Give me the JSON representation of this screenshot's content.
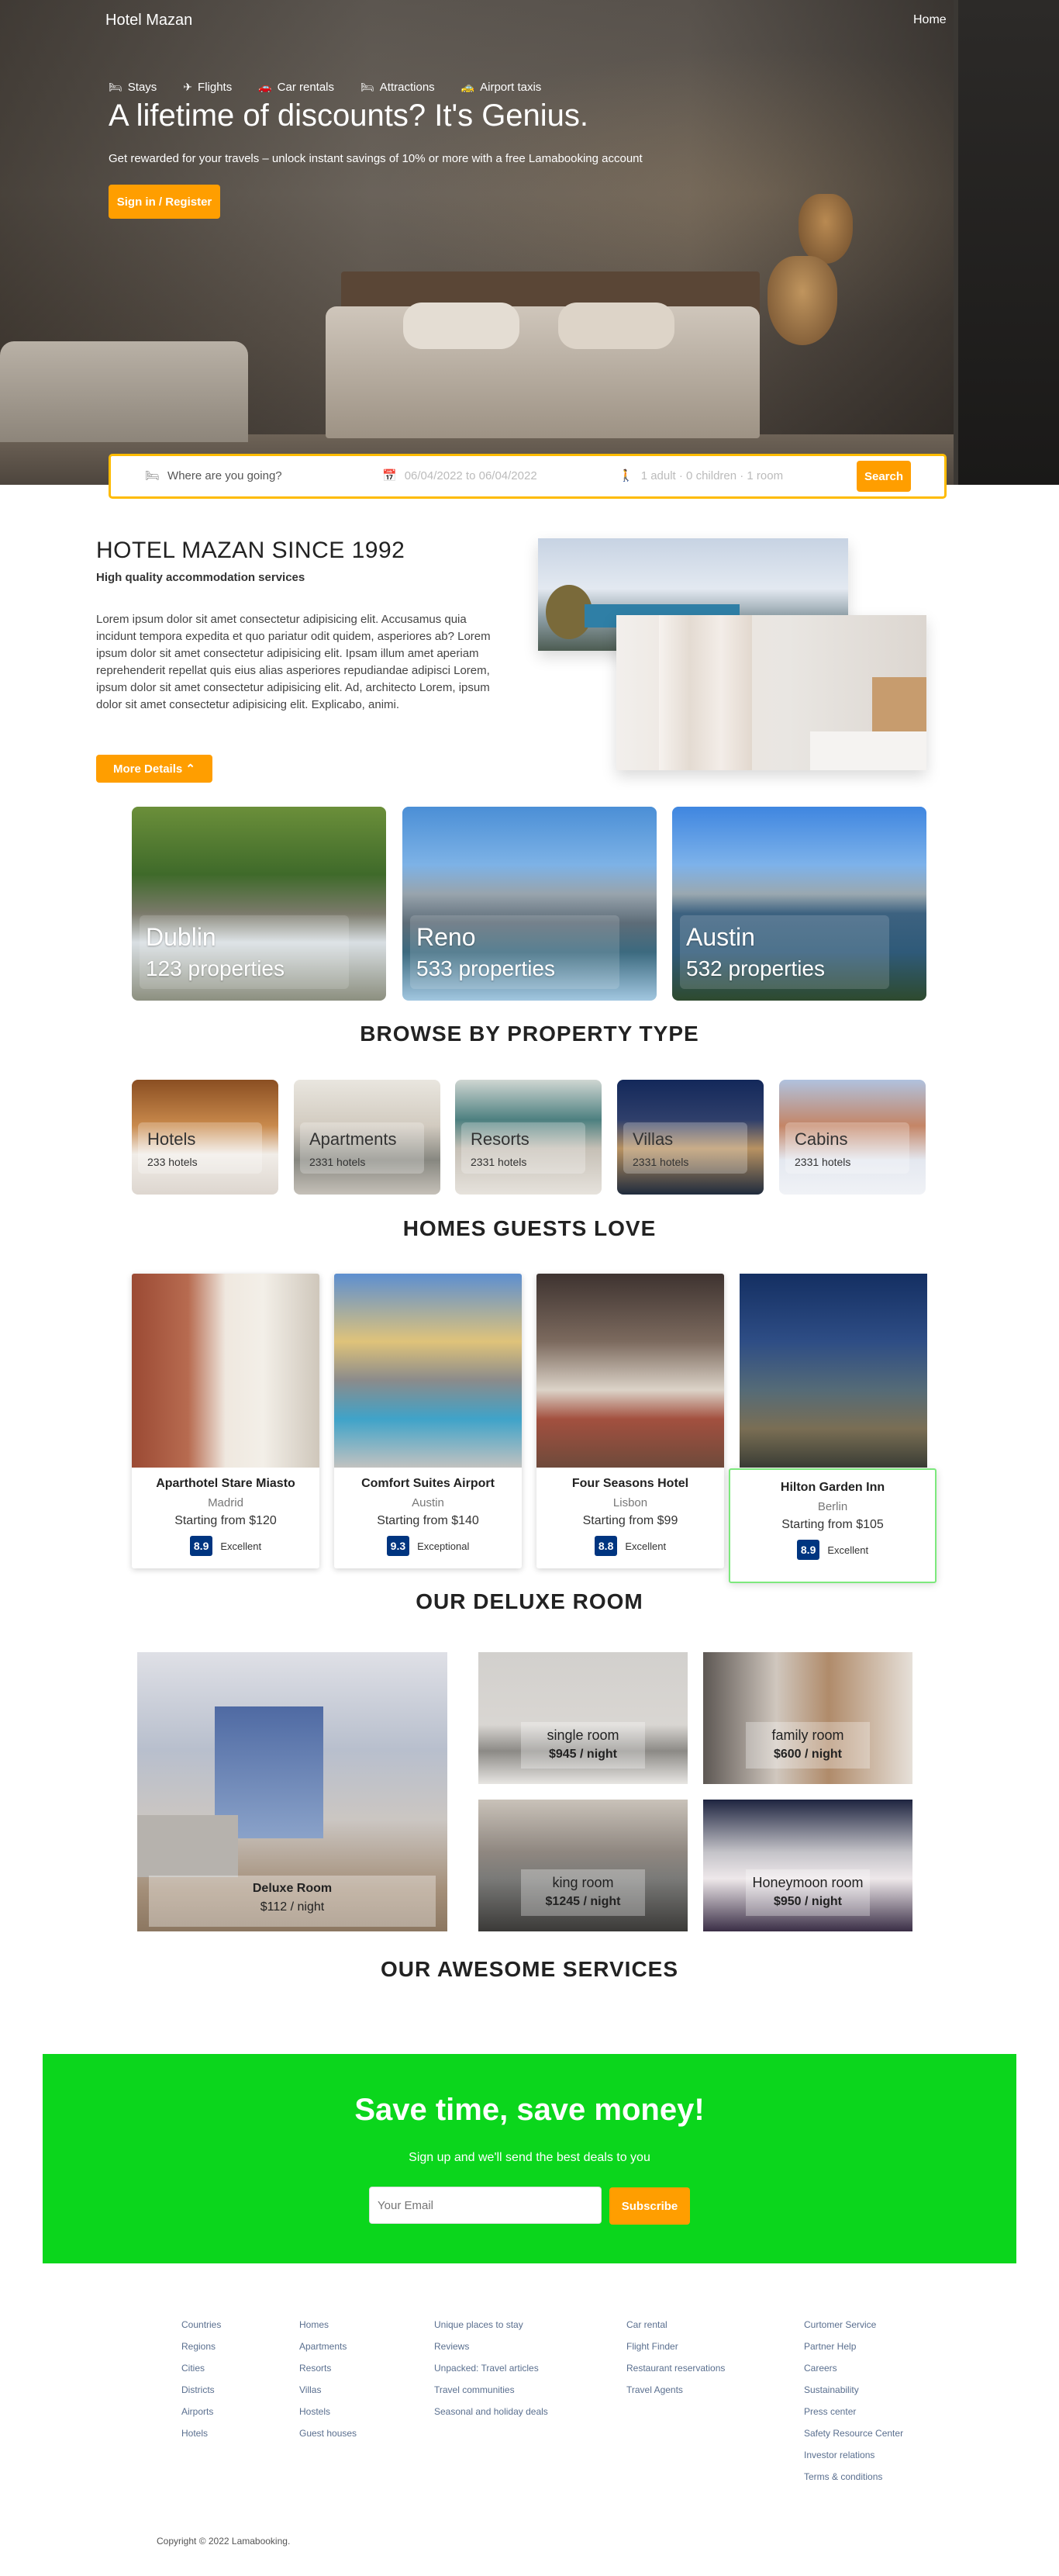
{
  "header": {
    "brand": "Hotel Mazan",
    "nav_home": "Home"
  },
  "hero": {
    "tabs": [
      {
        "label": "Stays",
        "icon": "bed-icon"
      },
      {
        "label": "Flights",
        "icon": "plane-icon"
      },
      {
        "label": "Car rentals",
        "icon": "car-icon"
      },
      {
        "label": "Attractions",
        "icon": "bed-icon"
      },
      {
        "label": "Airport taxis",
        "icon": "taxi-icon"
      }
    ],
    "title": "A lifetime of discounts? It's Genius.",
    "subtitle": "Get rewarded for your travels – unlock instant savings of 10% or more with a free Lamabooking account",
    "button": "Sign in / Register"
  },
  "search": {
    "destination_placeholder": "Where are you going?",
    "dates": "06/04/2022 to 06/04/2022",
    "people": "1 adult · 0 children · 1 room",
    "button": "Search"
  },
  "about": {
    "title": "HOTEL MAZAN SINCE 1992",
    "subtitle": "High quality accommodation services",
    "text": "Lorem ipsum dolor sit amet consectetur adipisicing elit. Accusamus quia incidunt tempora expedita et quo pariatur odit quidem, asperiores ab? Lorem ipsum dolor sit amet consectetur adipisicing elit. Ipsam illum amet aperiam reprehenderit repellat quis eius alias asperiores repudiandae adipisci Lorem, ipsum dolor sit amet consectetur adipisicing elit. Ad, architecto Lorem, ipsum dolor sit amet consectetur adipisicing elit. Explicabo, animi.",
    "button": "More Details"
  },
  "cities": [
    {
      "name": "Dublin",
      "properties": "123 properties"
    },
    {
      "name": "Reno",
      "properties": "533 properties"
    },
    {
      "name": "Austin",
      "properties": "532 properties"
    }
  ],
  "sections": {
    "browse": "BROWSE BY PROPERTY TYPE",
    "homes": "HOMES GUESTS LOVE",
    "deluxe": "OUR DELUXE ROOM",
    "services": "OUR AWESOME SERVICES"
  },
  "property_types": [
    {
      "name": "Hotels",
      "count": "233 hotels"
    },
    {
      "name": "Apartments",
      "count": "2331 hotels"
    },
    {
      "name": "Resorts",
      "count": "2331 hotels"
    },
    {
      "name": "Villas",
      "count": "2331 hotels"
    },
    {
      "name": "Cabins",
      "count": "2331 hotels"
    }
  ],
  "homes": [
    {
      "name": "Aparthotel Stare Miasto",
      "city": "Madrid",
      "price": "Starting from $120",
      "score": "8.9",
      "rating": "Excellent"
    },
    {
      "name": "Comfort Suites Airport",
      "city": "Austin",
      "price": "Starting from $140",
      "score": "9.3",
      "rating": "Exceptional"
    },
    {
      "name": "Four Seasons Hotel",
      "city": "Lisbon",
      "price": "Starting from $99",
      "score": "8.8",
      "rating": "Excellent"
    },
    {
      "name": "Hilton Garden Inn",
      "city": "Berlin",
      "price": "Starting from $105",
      "score": "8.9",
      "rating": "Excellent"
    }
  ],
  "deluxe": [
    {
      "name": "Deluxe Room",
      "price": "$112 / night"
    },
    {
      "name": "single room",
      "price": "$945 / night"
    },
    {
      "name": "family room",
      "price": "$600 / night"
    },
    {
      "name": "king room",
      "price": "$1245 / night"
    },
    {
      "name": "Honeymoon room",
      "price": "$950 / night"
    }
  ],
  "subscribe": {
    "title": "Save time, save money!",
    "text": "Sign up and we'll send the best deals to you",
    "placeholder": "Your Email",
    "button": "Subscribe"
  },
  "footer": {
    "col1": [
      "Countries",
      "Regions",
      "Cities",
      "Districts",
      "Airports",
      "Hotels"
    ],
    "col2": [
      "Homes",
      "Apartments",
      "Resorts",
      "Villas",
      "Hostels",
      "Guest houses"
    ],
    "col3": [
      "Unique places to stay",
      "Reviews",
      "Unpacked: Travel articles",
      "Travel communities",
      "Seasonal and holiday deals"
    ],
    "col4": [
      "Car rental",
      "Flight Finder",
      "Restaurant reservations",
      "Travel Agents"
    ],
    "col5": [
      "Curtomer Service",
      "Partner Help",
      "Careers",
      "Sustainability",
      "Press center",
      "Safety Resource Center",
      "Investor relations",
      "Terms & conditions"
    ],
    "copyright": "Copyright © 2022 Lamabooking."
  },
  "colors": {
    "accent": "#ff9e00",
    "brand_blue": "#003580",
    "subscribe_bg": "#0bd61c",
    "search_border": "#febb02"
  }
}
